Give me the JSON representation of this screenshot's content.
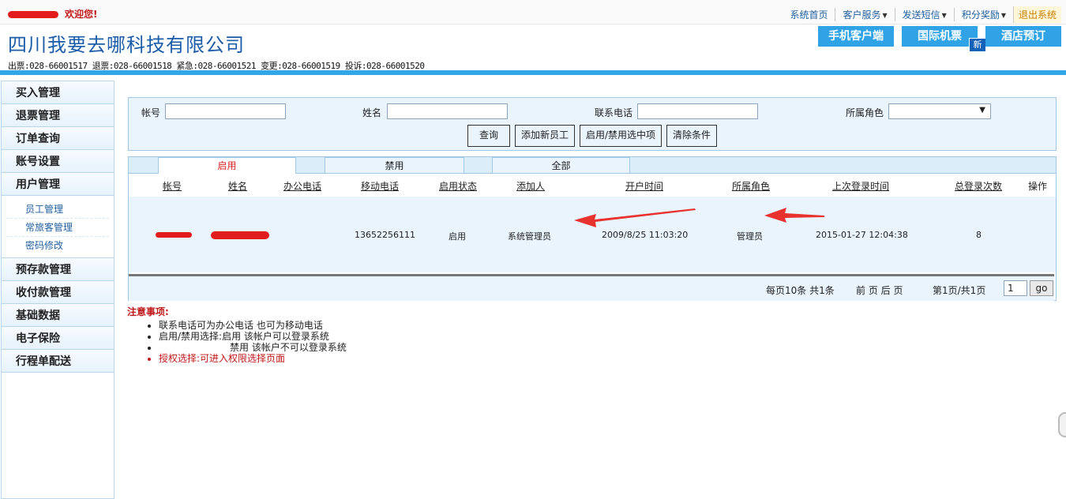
{
  "topbar": {
    "welcome": "欢迎您!",
    "nav": [
      {
        "label": "系统首页",
        "caret": false
      },
      {
        "label": "客户服务",
        "caret": true
      },
      {
        "label": "发送短信",
        "caret": true
      },
      {
        "label": "积分奖励",
        "caret": true
      }
    ],
    "logout": "退出系统"
  },
  "header": {
    "company": "四川我要去哪科技有限公司",
    "phones": "出票:028-66001517 退票:028-66001518 紧急:028-66001521 变更:028-66001519 投诉:028-66001520",
    "tabs": [
      "手机客户端",
      "国际机票",
      "酒店预订"
    ],
    "new_badge": "新"
  },
  "sidebar": {
    "items_top": [
      "买入管理",
      "退票管理",
      "订单查询",
      "账号设置",
      "用户管理"
    ],
    "sub_items": [
      "员工管理",
      "常旅客管理",
      "密码修改"
    ],
    "items_bottom": [
      "预存款管理",
      "收付款管理",
      "基础数据",
      "电子保险",
      "行程单配送"
    ]
  },
  "search": {
    "account_label": "帐号",
    "name_label": "姓名",
    "phone_label": "联系电话",
    "role_label": "所属角色",
    "buttons": [
      "查询",
      "添加新员工",
      "启用/禁用选中项",
      "清除条件"
    ]
  },
  "grid": {
    "tabs": [
      "启用",
      "禁用",
      "全部"
    ],
    "headers": [
      "帐号",
      "姓名",
      "办公电话",
      "移动电话",
      "启用状态",
      "添加人",
      "开户时间",
      "所属角色",
      "上次登录时间",
      "总登录次数",
      "操作"
    ],
    "row": {
      "mobile": "13652256111",
      "status": "启用",
      "added_by": "系统管理员",
      "open_time": "2009/8/25 11:03:20",
      "role": "管理员",
      "last_login": "2015-01-27 12:04:38",
      "login_count": "8"
    },
    "pager": {
      "per_page": "每页10条 共1条",
      "nav": "前 页 后 页",
      "page_info": "第1页/共1页",
      "page_input": "1",
      "go": "go"
    }
  },
  "notes": {
    "title": "注意事项:",
    "items": [
      "联系电话可为办公电话 也可为移动电话",
      "启用/禁用选择:启用 该帐户可以登录系统",
      "禁用 该帐户不可以登录系统",
      "授权选择:可进入权限选择页面"
    ]
  },
  "colors": {
    "brand_blue": "#1a5ca8",
    "tab_blue": "#2fa3e6",
    "panel_bg": "#eaf4fc",
    "alert_red": "#c01a1a",
    "annotation_arrow": "#e8322e"
  }
}
